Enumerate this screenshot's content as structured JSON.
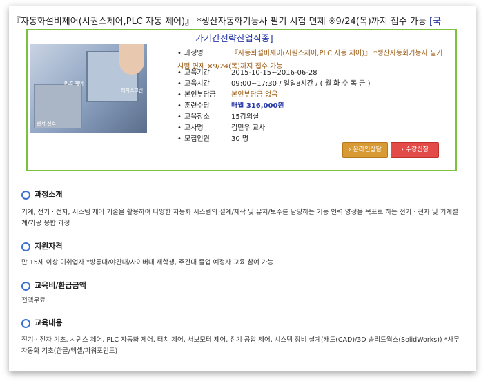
{
  "header": {
    "title": "『자동화설비제어(시퀀스제어,PLC 자동 제어)』 *생산자동화기능사 필기 시험 면제 ※9/24(목)까지 접수 가능",
    "title_link_suffix": "[국"
  },
  "company": "가기간전략산업직종]",
  "image_tags": {
    "plc": "PLC 제어",
    "sensor": "센서 신호",
    "touch": "터치스크린"
  },
  "details": {
    "course_label": "과정명",
    "course_value": "『자동화설비제어(시퀀스제어,PLC 자동 제어)』 *생산자동화기능사 필기",
    "course_wrap": "시험 면제 ※9/24(목)까지 접수 가능",
    "period_label": "교육기간",
    "period_value": "2015-10-15~2016-06-28",
    "time_label": "교육시간",
    "time_value": "09:00~17:30 / 일일8시간 / ( 월 화 수 목 금 )",
    "self_pay_label": "본인부담금",
    "self_pay_value": "본인부담금 없음",
    "fee_label": "훈련수당",
    "fee_value": "매월 316,000원",
    "place_label": "교육장소",
    "place_value": "15강의실",
    "teacher_label": "교사명",
    "teacher_value": "김민우 교사",
    "capacity_label": "모집인원",
    "capacity_value": "30 명"
  },
  "buttons": {
    "online": "온라인상담",
    "apply": "수강신청"
  },
  "sections": [
    {
      "title": "과정소개",
      "text": "기계, 전기 · 전자, 시스템 제어 기술을 활용하여 다양한 자동화 시스템의 설계/제작 및 유지/보수를 담당하는 기능 인력 양성을 목표로 하는 전기 · 전자 및 기계설계/가공 융합 과정"
    },
    {
      "title": "지원자격",
      "text": "만 15세 이상 미취업자 *방통대/야간대/사이버대 재학생, 주간대 졸업 예정자 교육 참여 가능"
    },
    {
      "title": "교육비/환급금액",
      "text": "전액무료"
    },
    {
      "title": "교육내용",
      "text": "전기 · 전자 기초, 시퀀스 제어, PLC 자동화 제어, 터치 제어, 서보모터 제어, 전기 공압 제어, 시스템 장비 설계(캐드(CAD)/3D 솔리드웍스(SolidWorks)) *사무자동화 기초(한글/엑셀/파워포인트)"
    }
  ],
  "colors": {
    "accent_green": "#7ac142",
    "link_blue": "#2a3aa8",
    "brown": "#9b5a12",
    "online_btn": "#d79a35",
    "apply_btn": "#e24b48"
  }
}
